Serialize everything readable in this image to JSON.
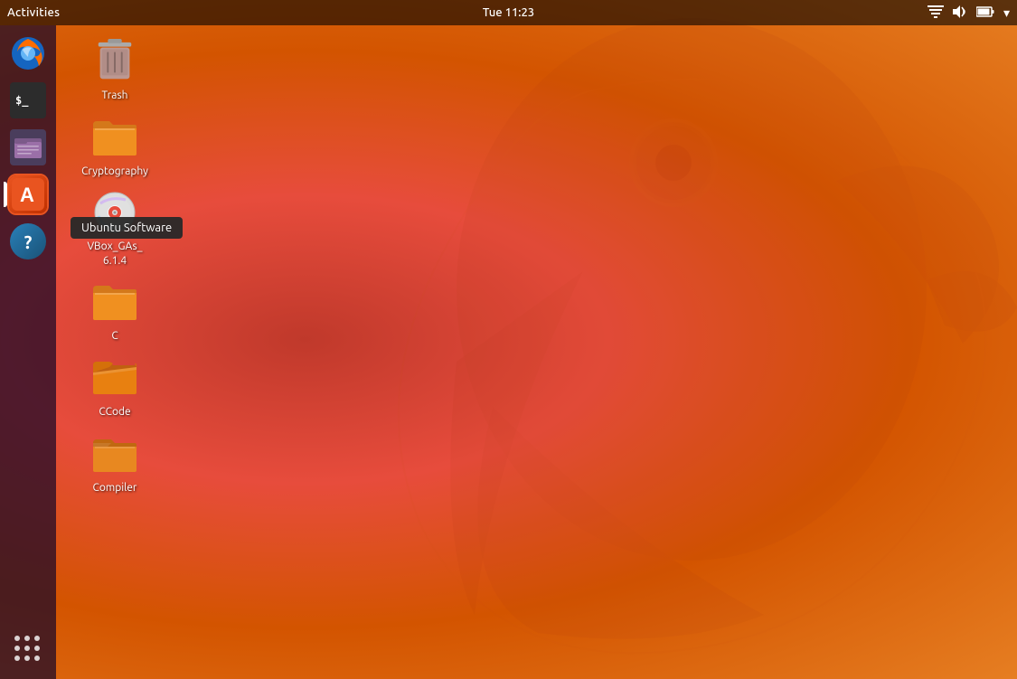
{
  "topbar": {
    "activities_label": "Activities",
    "datetime": "Tue 11:23",
    "icons": {
      "network": "⊞",
      "sound": "🔊",
      "battery": "🔋",
      "menu": "▾"
    }
  },
  "dock": {
    "items": [
      {
        "id": "firefox",
        "label": "Firefox",
        "active": false
      },
      {
        "id": "terminal",
        "label": "Terminal",
        "active": false
      },
      {
        "id": "files",
        "label": "Files",
        "active": false
      },
      {
        "id": "ubuntu-software",
        "label": "Ubuntu Software",
        "active": true,
        "tooltip": "Ubuntu Software"
      },
      {
        "id": "help",
        "label": "Help",
        "active": false
      }
    ],
    "show_apps_label": "Show Applications"
  },
  "desktop": {
    "icons": [
      {
        "id": "trash",
        "label": "Trash",
        "type": "trash"
      },
      {
        "id": "cryptography",
        "label": "Cryptography",
        "type": "folder-orange"
      },
      {
        "id": "vbox",
        "label": "VBox_GAs_\n6.1.4",
        "type": "cd"
      },
      {
        "id": "c-folder",
        "label": "C",
        "type": "folder-orange"
      },
      {
        "id": "ccode-folder",
        "label": "CCode",
        "type": "folder-orange-open"
      },
      {
        "id": "compiler-folder",
        "label": "Compiler",
        "type": "folder-orange-half"
      }
    ]
  }
}
